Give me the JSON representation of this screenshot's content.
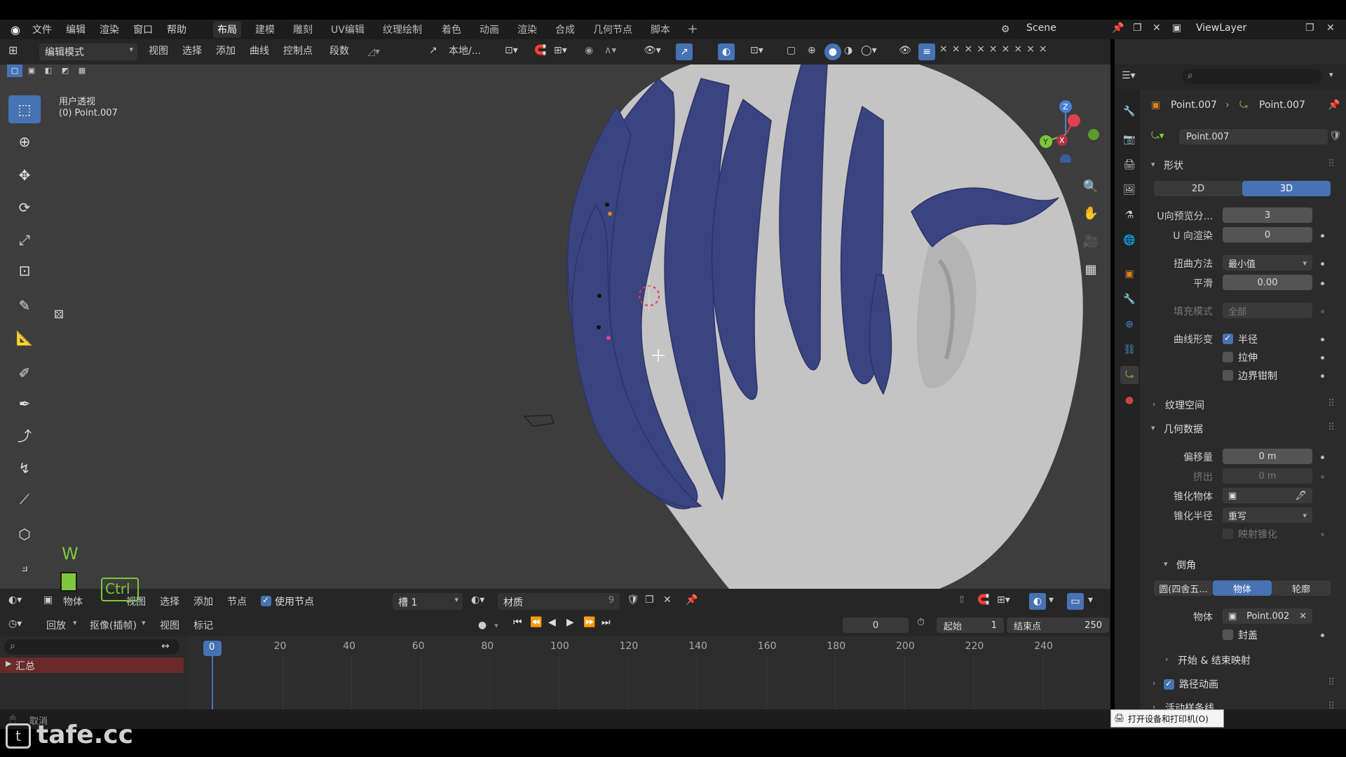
{
  "topbar": {
    "menus": [
      "文件",
      "编辑",
      "渲染",
      "窗口",
      "帮助"
    ],
    "workspaces": [
      "布局",
      "建模",
      "雕刻",
      "UV编辑",
      "纹理绘制",
      "着色",
      "动画",
      "渲染",
      "合成",
      "几何节点",
      "脚本"
    ],
    "active_workspace": "布局",
    "scene": "Scene",
    "view_layer": "ViewLayer"
  },
  "viewport_header": {
    "mode": "编辑模式",
    "menus": [
      "视图",
      "选择",
      "添加",
      "曲线",
      "控制点",
      "段数"
    ],
    "pivot": "本地/..."
  },
  "viewport": {
    "view_name": "用户透视",
    "object_name": "(0) Point.007",
    "key_overlay": "W",
    "key_ctrl": "Ctrl"
  },
  "node_header": {
    "type": "物体",
    "menus": [
      "视图",
      "选择",
      "添加",
      "节点"
    ],
    "use_nodes_label": "使用节点",
    "slot": "槽 1",
    "material": "材质",
    "material_users": "9"
  },
  "timeline": {
    "playback": "回放",
    "keying": "抠像(插帧)",
    "view": "视图",
    "marker": "标记",
    "current_frame": "0",
    "start_label": "起始",
    "start_value": "1",
    "end_label": "结束点",
    "end_value": "250",
    "ticks": [
      "0",
      "20",
      "40",
      "60",
      "80",
      "100",
      "120",
      "140",
      "160",
      "180",
      "200",
      "220",
      "240"
    ],
    "summary": "汇总",
    "status_cancel": "取消"
  },
  "properties": {
    "breadcrumb_obj": "Point.007",
    "breadcrumb_data": "Point.007",
    "datablock": "Point.007",
    "shape_title": "形状",
    "dim_2d": "2D",
    "dim_3d": "3D",
    "u_preview_label": "U向预览分...",
    "u_preview_value": "3",
    "u_render_label": "U 向渲染",
    "u_render_value": "0",
    "twist_label": "扭曲方法",
    "twist_value": "最小值",
    "smooth_label": "平滑",
    "smooth_value": "0.00",
    "fill_label": "填充模式",
    "fill_value": "全部",
    "deform_label": "曲线形变",
    "radius_label": "半径",
    "stretch_label": "拉伸",
    "clamp_label": "边界钳制",
    "texture_space": "纹理空间",
    "geometry_title": "几何数据",
    "offset_label": "偏移量",
    "offset_value": "0 m",
    "extrude_label": "挤出",
    "extrude_value": "0 m",
    "taper_obj_label": "锥化物体",
    "taper_radius_label": "锥化半径",
    "taper_radius_value": "重写",
    "map_taper_label": "映射锥化",
    "bevel_title": "倒角",
    "bevel_round": "圆(四舍五...",
    "bevel_object": "物体",
    "bevel_profile": "轮廓",
    "bevel_obj_label": "物体",
    "bevel_obj_value": "Point.002",
    "fill_caps_label": "封盖",
    "start_end_mapping": "开始 & 结束映射",
    "path_anim": "路径动画",
    "active_spline": "活动样条线"
  },
  "tooltip": "打开设备和打印机(O)",
  "watermark": "tafe.cc",
  "colors": {
    "accent": "#4772b3",
    "hair": "#3a4480",
    "head": "#c4c4c4",
    "viewport_bg": "#3d3d3d"
  }
}
